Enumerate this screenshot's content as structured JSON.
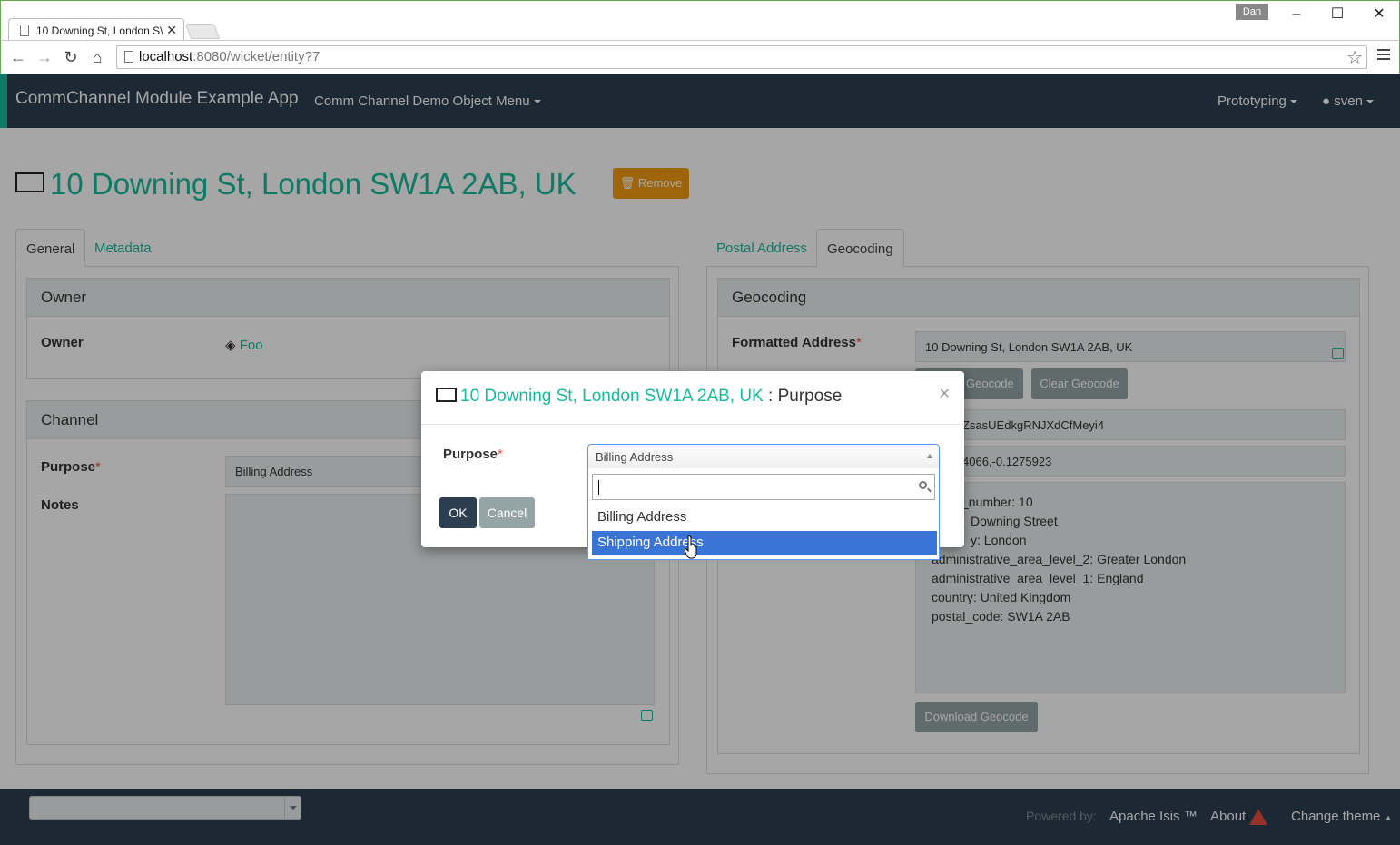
{
  "browser": {
    "tab_title": "10 Downing St, London S\\",
    "user_badge": "Dan",
    "url_host": "localhost",
    "url_path": ":8080/wicket/entity?7"
  },
  "navbar": {
    "brand": "CommChannel Module Example App",
    "menu_demo": "Comm Channel Demo Object Menu",
    "menu_prototyping": "Prototyping",
    "menu_user": "sven"
  },
  "entity": {
    "title": "10 Downing St, London SW1A 2AB, UK",
    "remove_label": "Remove"
  },
  "left_tabs": [
    "General",
    "Metadata"
  ],
  "right_tabs": [
    "Postal Address",
    "Geocoding"
  ],
  "owner_panel": {
    "heading": "Owner",
    "owner_label": "Owner",
    "owner_value": "Foo"
  },
  "channel_panel": {
    "heading": "Channel",
    "purpose_label": "Purpose",
    "purpose_value": "Billing Address",
    "notes_label": "Notes",
    "required_marker": "*"
  },
  "geocoding_panel": {
    "heading": "Geocoding",
    "formatted_label": "Formatted Address",
    "formatted_value": "10 Downing St, London SW1A 2AB, UK",
    "lookup_label": "Geocode",
    "clear_label": "Clear Geocode",
    "place_id_partial": "ZsasUEdkgRNJXdCfMeyi4",
    "latlng_partial": "4066,-0.1275923",
    "details_lines": [
      "_number: 10",
      "Downing Street",
      "y: London",
      "administrative_area_level_2: Greater London",
      "administrative_area_level_1: England",
      "country: United Kingdom",
      "postal_code: SW1A 2AB"
    ],
    "download_label": "Download Geocode"
  },
  "footer": {
    "powered_by": "Powered by:",
    "framework": "Apache Isis ™",
    "about": "About",
    "change_theme": "Change theme"
  },
  "modal": {
    "title_link": "10 Downing St, London SW1A 2AB, UK",
    "title_sep": " : ",
    "title_action": "Purpose",
    "purpose_label": "Purpose",
    "selected_value": "Billing Address",
    "search_placeholder": "",
    "options": [
      "Billing Address",
      "Shipping Address"
    ],
    "highlighted_option": "Shipping Address",
    "ok_label": "OK",
    "cancel_label": "Cancel"
  },
  "colors": {
    "accent": "#18bc9c",
    "navbar": "#2c3e50",
    "warning": "#f39c12",
    "highlight": "#3875d7"
  }
}
